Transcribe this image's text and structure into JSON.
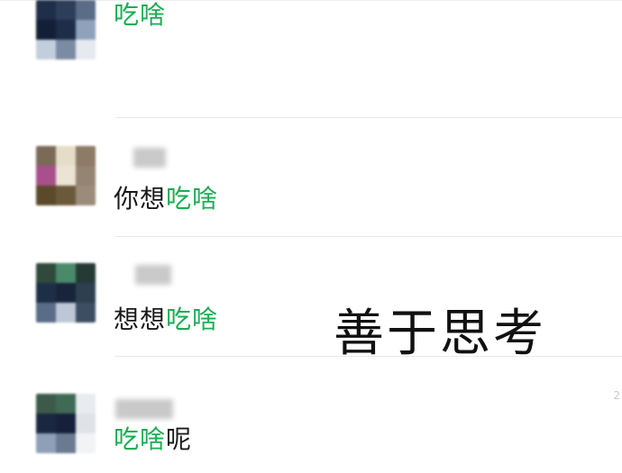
{
  "messages": [
    {
      "pre": "你想",
      "highlight": "吃啥",
      "post": "",
      "avatar_colors": [
        "#7b6a58",
        "#e6ddc8",
        "#8d7b66",
        "#a84f8c",
        "#ebe4d4",
        "#958471",
        "#5b4a2a",
        "#6b5a3a",
        "#9a8c79"
      ]
    },
    {
      "pre": "想想",
      "highlight": "吃啥",
      "post": "",
      "avatar_colors": [
        "#2f4a3c",
        "#4a8a6a",
        "#253a35",
        "#1d2f47",
        "#18243c",
        "#2c4050",
        "#5a6d86",
        "#bcc8d6",
        "#3c4e62"
      ]
    },
    {
      "pre": "",
      "highlight": "吃啥",
      "post": "呢",
      "avatar_colors": [
        "#3d5a48",
        "#3f6a55",
        "#e8ecef",
        "#1a2740",
        "#16203a",
        "#dfe3e8",
        "#8ea0b8",
        "#6b7a90",
        "#f2f3f5"
      ]
    },
    {
      "pre": "",
      "highlight": "吃啥",
      "post": "",
      "avatar_colors": [
        "#1f2f49",
        "#2c3e5a",
        "#5a6c86",
        "#131f36",
        "#1e2d48",
        "#8fa2bc",
        "#c3cedd",
        "#7a8ba3",
        "#e6eaf0"
      ]
    }
  ],
  "caption": "善于思考",
  "edge_mark": "2",
  "colors": {
    "highlight": "#1aad52",
    "text": "#1a1a1a"
  }
}
